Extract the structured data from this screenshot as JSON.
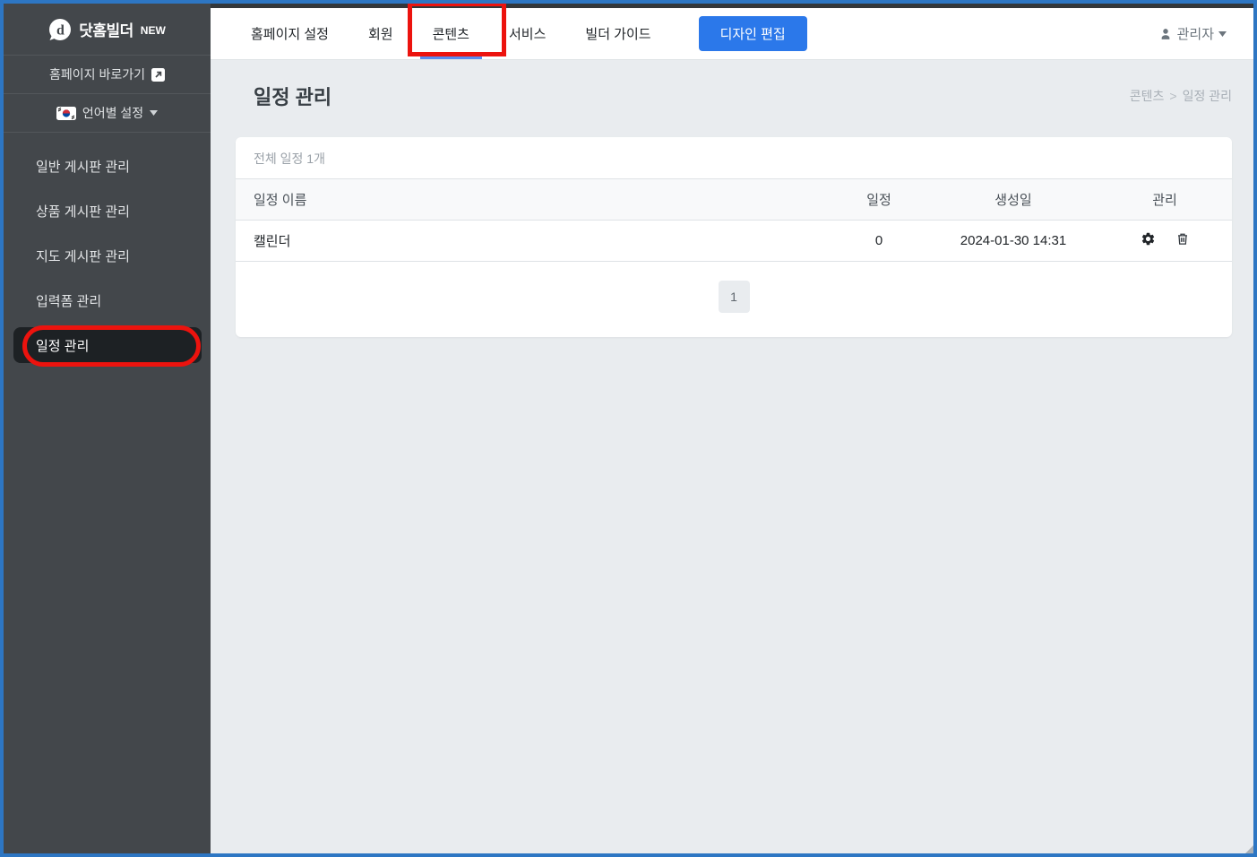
{
  "colors": {
    "window_border_blue": "#2d76c3",
    "annotation_red": "#ec130e",
    "accent_blue": "#2b78ea",
    "active_tab_underline": "#5b8bef",
    "sidebar_bg": "#43474b",
    "sidebar_active_bg": "#1d2124",
    "main_bg": "#e9ecef"
  },
  "sidebar": {
    "logo": {
      "title": "닷홈빌더",
      "badge": "NEW"
    },
    "shortcut": {
      "label": "홈페이지 바로가기"
    },
    "language": {
      "label": "언어별 설정"
    },
    "menu": [
      {
        "label": "일반 게시판 관리",
        "active": false
      },
      {
        "label": "상품 게시판 관리",
        "active": false
      },
      {
        "label": "지도 게시판 관리",
        "active": false
      },
      {
        "label": "입력폼 관리",
        "active": false
      },
      {
        "label": "일정 관리",
        "active": true
      }
    ]
  },
  "header": {
    "tabs": [
      {
        "label": "홈페이지 설정",
        "active": false
      },
      {
        "label": "회원",
        "active": false
      },
      {
        "label": "콘텐츠",
        "active": true
      },
      {
        "label": "서비스",
        "active": false
      },
      {
        "label": "빌더 가이드",
        "active": false
      }
    ],
    "design_button": "디자인 편집",
    "user": {
      "label": "관리자"
    }
  },
  "main": {
    "title": "일정 관리",
    "breadcrumb": {
      "items": [
        "콘텐츠",
        "일정 관리"
      ],
      "separator": ">"
    },
    "card": {
      "summary": "전체 일정 1개",
      "table": {
        "headers": [
          "일정 이름",
          "일정",
          "생성일",
          "관리"
        ],
        "rows": [
          {
            "name": "캘린더",
            "count": "0",
            "created": "2024-01-30 14:31"
          }
        ]
      },
      "pagination": [
        "1"
      ]
    }
  }
}
